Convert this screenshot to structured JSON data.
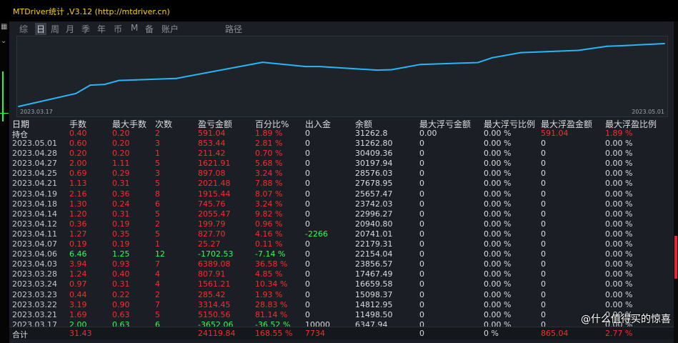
{
  "window": {
    "title": "MTDriver统计 ,V3.12 (http://mtdriver.cn)"
  },
  "tabs": [
    "综",
    "日",
    "周",
    "月",
    "季",
    "年",
    "币",
    "M",
    "备",
    "账户",
    "路径"
  ],
  "active_tab": "日",
  "chart_dates": {
    "start": "2023.03.17",
    "end": "2023.05.01"
  },
  "chart_data": {
    "type": "line",
    "x": [
      "2023.03.17",
      "2023.03.21",
      "2023.03.22",
      "2023.03.23",
      "2023.03.24",
      "2023.03.28",
      "2023.04.03",
      "2023.04.06",
      "2023.04.07",
      "2023.04.11",
      "2023.04.12",
      "2023.04.14",
      "2023.04.18",
      "2023.04.19",
      "2023.04.21",
      "2023.04.25",
      "2023.04.27",
      "2023.04.28",
      "2023.05.01"
    ],
    "values": [
      6347.94,
      11498.5,
      14812.95,
      15098.37,
      16659.58,
      17467.49,
      23856.57,
      22154.04,
      22179.31,
      20741.01,
      20940.8,
      22996.27,
      23742.03,
      25657.47,
      27678.95,
      28576.03,
      30197.94,
      30409.36,
      31262.8
    ],
    "color": "#29b6f6"
  },
  "columns": [
    "日期",
    "手数",
    "最大手数",
    "次数",
    "盈亏金额",
    "百分比%",
    "出入金",
    "余额",
    "最大浮亏金额",
    "最大浮亏比例",
    "最大浮盈金额",
    "最大浮盈比例"
  ],
  "holding": [
    "持仓",
    "0.40",
    "0.20",
    "2",
    "591.04",
    "1.89 %",
    "0",
    "31262.8",
    "0.00",
    "0.00 %",
    "591.04",
    "1.89 %"
  ],
  "rows": [
    [
      "2023.05.01",
      "0.60",
      "0.20",
      "3",
      "853.44",
      "2.81 %",
      "0",
      "31262.80",
      "0",
      "0.00 %",
      "0",
      "0.00 %"
    ],
    [
      "2023.04.28",
      "0.20",
      "0.20",
      "1",
      "211.42",
      "0.70 %",
      "0",
      "30409.36",
      "0",
      "0.00 %",
      "0",
      "0.00 %"
    ],
    [
      "2023.04.27",
      "2.00",
      "1.11",
      "5",
      "1621.91",
      "5.68 %",
      "0",
      "30197.94",
      "0",
      "0.00 %",
      "0",
      "0.00 %"
    ],
    [
      "2023.04.25",
      "0.69",
      "0.29",
      "3",
      "897.08",
      "3.24 %",
      "0",
      "28576.03",
      "0",
      "0.00 %",
      "0",
      "0.00 %"
    ],
    [
      "2023.04.21",
      "1.13",
      "0.31",
      "5",
      "2021.48",
      "7.88 %",
      "0",
      "27678.95",
      "0",
      "0.00 %",
      "0",
      "0.00 %"
    ],
    [
      "2023.04.19",
      "2.16",
      "0.36",
      "8",
      "1915.44",
      "8.07 %",
      "0",
      "25657.47",
      "0",
      "0.00 %",
      "0",
      "0.00 %"
    ],
    [
      "2023.04.18",
      "1.30",
      "0.24",
      "6",
      "745.76",
      "3.24 %",
      "0",
      "23742.03",
      "0",
      "0.00 %",
      "0",
      "0.00 %"
    ],
    [
      "2023.04.14",
      "1.20",
      "0.31",
      "5",
      "2055.47",
      "9.82 %",
      "0",
      "22996.27",
      "0",
      "0.00 %",
      "0",
      "0.00 %"
    ],
    [
      "2023.04.12",
      "0.36",
      "0.19",
      "2",
      "199.79",
      "0.96 %",
      "0",
      "20940.80",
      "0",
      "0.00 %",
      "0",
      "0.00 %"
    ],
    [
      "2023.04.11",
      "1.27",
      "0.35",
      "5",
      "827.70",
      "4.16 %",
      "-2266",
      "20741.01",
      "0",
      "0.00 %",
      "0",
      "0.00 %"
    ],
    [
      "2023.04.07",
      "0.19",
      "0.19",
      "1",
      "25.27",
      "0.11 %",
      "0",
      "22179.31",
      "0",
      "0.00 %",
      "0",
      "0.00 %"
    ],
    [
      "2023.04.06",
      "6.46",
      "1.25",
      "12",
      "-1702.53",
      "-7.14 %",
      "0",
      "22154.04",
      "0",
      "0.00 %",
      "0",
      "0.00 %"
    ],
    [
      "2023.04.03",
      "3.94",
      "0.93",
      "7",
      "6389.08",
      "36.58 %",
      "0",
      "23856.57",
      "0",
      "0.00 %",
      "0",
      "0.00 %"
    ],
    [
      "2023.03.28",
      "1.24",
      "0.40",
      "4",
      "807.91",
      "4.85 %",
      "0",
      "17467.49",
      "0",
      "0.00 %",
      "0",
      "0.00 %"
    ],
    [
      "2023.03.24",
      "0.97",
      "0.31",
      "4",
      "1561.21",
      "10.34 %",
      "0",
      "16659.58",
      "0",
      "0.00 %",
      "0",
      "0.00 %"
    ],
    [
      "2023.03.23",
      "0.44",
      "0.22",
      "2",
      "285.42",
      "1.93 %",
      "0",
      "15098.37",
      "0",
      "0.00 %",
      "0",
      "0.00 %"
    ],
    [
      "2023.03.22",
      "3.19",
      "0.90",
      "7",
      "3314.45",
      "28.83 %",
      "0",
      "14812.95",
      "0",
      "0.00 %",
      "0",
      "0.00 %"
    ],
    [
      "2023.03.21",
      "1.69",
      "0.63",
      "5",
      "5150.56",
      "81.14 %",
      "0",
      "11498.50",
      "0",
      "0.00 %",
      "0",
      "0.00 %"
    ],
    [
      "2023.03.17",
      "2.00",
      "0.63",
      "6",
      "-3652.06",
      "-36.52 %",
      "10000",
      "6347.94",
      "0",
      "0.00 %",
      "0",
      "0.00 %"
    ]
  ],
  "totals": [
    "合计",
    "31.43",
    "",
    "",
    "24119.84",
    "168.55 %",
    "7734",
    "",
    "0",
    "0 %",
    "865.04",
    "2.77 %"
  ],
  "colors": {
    "profit": "#ff2a2a",
    "loss": "#2bff52",
    "title": "#ffd200"
  },
  "watermark": "@什么值得买的惊喜"
}
